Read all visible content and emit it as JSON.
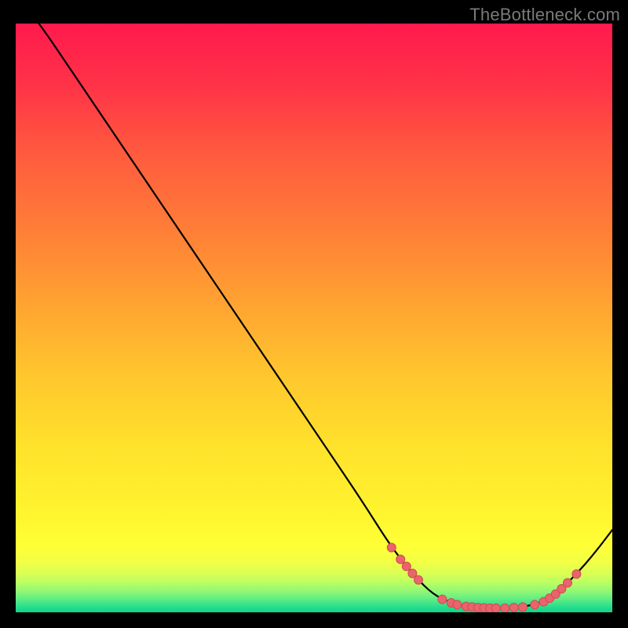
{
  "watermark": "TheBottleneck.com",
  "colors": {
    "marker_fill": "#e9646b",
    "marker_stroke": "#d14b53",
    "curve_stroke": "#000000"
  },
  "chart_data": {
    "type": "line",
    "title": "",
    "xlabel": "",
    "ylabel": "",
    "xlim": [
      0,
      100
    ],
    "ylim": [
      0,
      100
    ],
    "x": [
      0,
      4,
      10,
      16,
      22,
      28,
      34,
      40,
      46,
      52,
      58,
      63,
      67,
      70,
      73,
      76,
      79,
      82,
      85,
      88,
      91,
      94,
      97,
      100
    ],
    "values": [
      105,
      100,
      91,
      82,
      73,
      64,
      55,
      46,
      37,
      28,
      19,
      11,
      6,
      3,
      1.6,
      0.9,
      0.7,
      0.7,
      0.9,
      1.6,
      3.5,
      6.5,
      10,
      14
    ],
    "gradient_stops": [
      {
        "offset": 0.0,
        "color": "#ff1a4d"
      },
      {
        "offset": 0.1,
        "color": "#ff3148"
      },
      {
        "offset": 0.22,
        "color": "#ff5a3e"
      },
      {
        "offset": 0.35,
        "color": "#ff7e37"
      },
      {
        "offset": 0.48,
        "color": "#ffa431"
      },
      {
        "offset": 0.6,
        "color": "#ffc72d"
      },
      {
        "offset": 0.72,
        "color": "#ffe22c"
      },
      {
        "offset": 0.82,
        "color": "#fff22e"
      },
      {
        "offset": 0.885,
        "color": "#ffff35"
      },
      {
        "offset": 0.915,
        "color": "#f2ff45"
      },
      {
        "offset": 0.935,
        "color": "#d8ff55"
      },
      {
        "offset": 0.952,
        "color": "#b4fd65"
      },
      {
        "offset": 0.965,
        "color": "#8ef776"
      },
      {
        "offset": 0.976,
        "color": "#66ee82"
      },
      {
        "offset": 0.985,
        "color": "#3fe58a"
      },
      {
        "offset": 0.992,
        "color": "#22dd8c"
      },
      {
        "offset": 1.0,
        "color": "#10d488"
      }
    ],
    "markers": [
      {
        "x": 63.0,
        "y": 11.0
      },
      {
        "x": 64.5,
        "y": 9.0
      },
      {
        "x": 65.5,
        "y": 7.8
      },
      {
        "x": 66.5,
        "y": 6.6
      },
      {
        "x": 67.5,
        "y": 5.5
      },
      {
        "x": 71.5,
        "y": 2.2
      },
      {
        "x": 73.0,
        "y": 1.6
      },
      {
        "x": 74.0,
        "y": 1.3
      },
      {
        "x": 75.5,
        "y": 1.0
      },
      {
        "x": 76.5,
        "y": 0.9
      },
      {
        "x": 77.5,
        "y": 0.8
      },
      {
        "x": 78.5,
        "y": 0.75
      },
      {
        "x": 79.5,
        "y": 0.7
      },
      {
        "x": 80.5,
        "y": 0.7
      },
      {
        "x": 82.0,
        "y": 0.7
      },
      {
        "x": 83.5,
        "y": 0.8
      },
      {
        "x": 85.0,
        "y": 0.9
      },
      {
        "x": 87.0,
        "y": 1.3
      },
      {
        "x": 88.5,
        "y": 1.8
      },
      {
        "x": 89.5,
        "y": 2.4
      },
      {
        "x": 90.5,
        "y": 3.1
      },
      {
        "x": 91.5,
        "y": 4.0
      },
      {
        "x": 92.5,
        "y": 5.0
      },
      {
        "x": 94.0,
        "y": 6.5
      }
    ]
  }
}
